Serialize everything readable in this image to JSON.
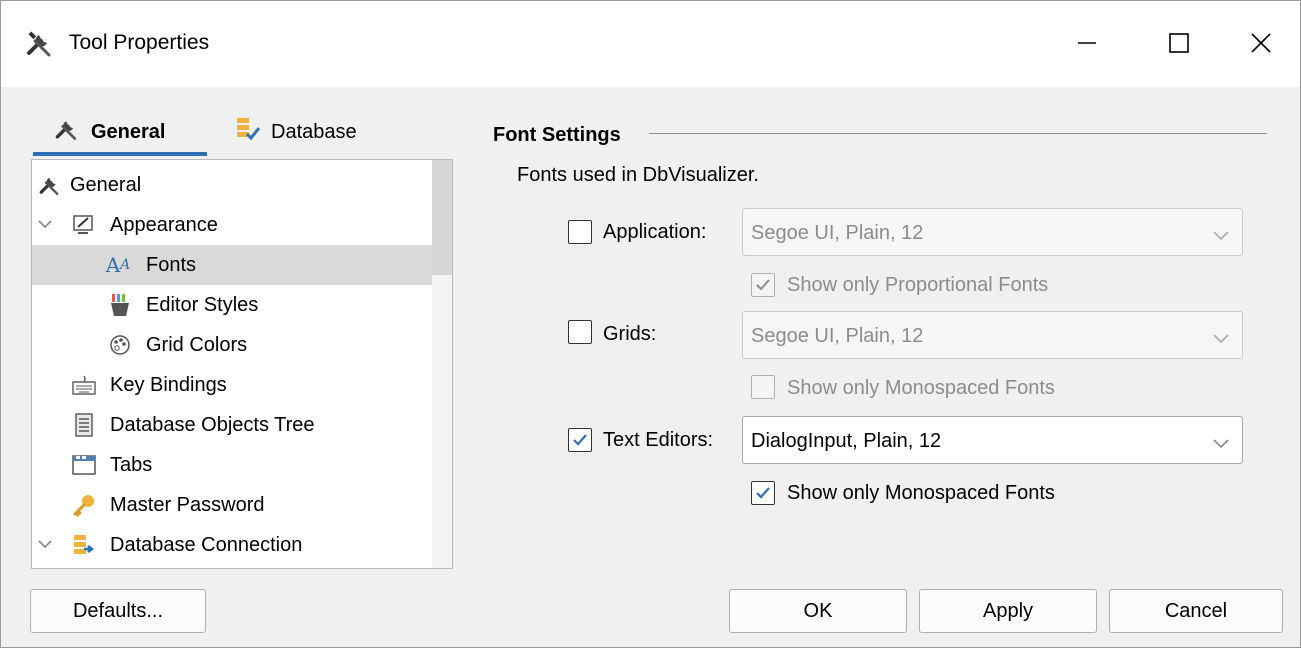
{
  "window": {
    "title": "Tool Properties",
    "title_icon": "tools-icon"
  },
  "tabs": [
    {
      "label": "General",
      "icon": "tools-icon",
      "active": true
    },
    {
      "label": "Database",
      "icon": "database-icon",
      "active": false
    }
  ],
  "tree": {
    "items": [
      {
        "label": "General",
        "icon": "tools-icon"
      },
      {
        "label": "Appearance",
        "icon": "appearance-icon",
        "expanded": true
      },
      {
        "label": "Fonts",
        "icon": "fonts-icon",
        "selected": true
      },
      {
        "label": "Editor Styles",
        "icon": "editor-styles-icon"
      },
      {
        "label": "Grid Colors",
        "icon": "palette-icon"
      },
      {
        "label": "Key Bindings",
        "icon": "keyboard-icon"
      },
      {
        "label": "Database Objects Tree",
        "icon": "objects-tree-icon"
      },
      {
        "label": "Tabs",
        "icon": "tabs-icon"
      },
      {
        "label": "Master Password",
        "icon": "key-icon"
      },
      {
        "label": "Database Connection",
        "icon": "database-connection-icon",
        "expanded": true
      }
    ]
  },
  "font_settings": {
    "title": "Font Settings",
    "description": "Fonts used in DbVisualizer.",
    "rows": [
      {
        "label": "Application:",
        "checked": false,
        "value": "Segoe UI, Plain, 12",
        "enabled": false,
        "sub_label": "Show only Proportional Fonts",
        "sub_checked": true,
        "sub_enabled": false
      },
      {
        "label": "Grids:",
        "checked": false,
        "value": "Segoe UI, Plain, 12",
        "enabled": false,
        "sub_label": "Show only Monospaced Fonts",
        "sub_checked": false,
        "sub_enabled": false
      },
      {
        "label": "Text Editors:",
        "checked": true,
        "value": "DialogInput, Plain, 12",
        "enabled": true,
        "sub_label": "Show only Monospaced Fonts",
        "sub_checked": true,
        "sub_enabled": true
      }
    ]
  },
  "buttons": {
    "defaults": "Defaults...",
    "ok": "OK",
    "apply": "Apply",
    "cancel": "Cancel"
  },
  "colors": {
    "accent": "#2f6fb3",
    "selection": "#d9d9d9"
  }
}
